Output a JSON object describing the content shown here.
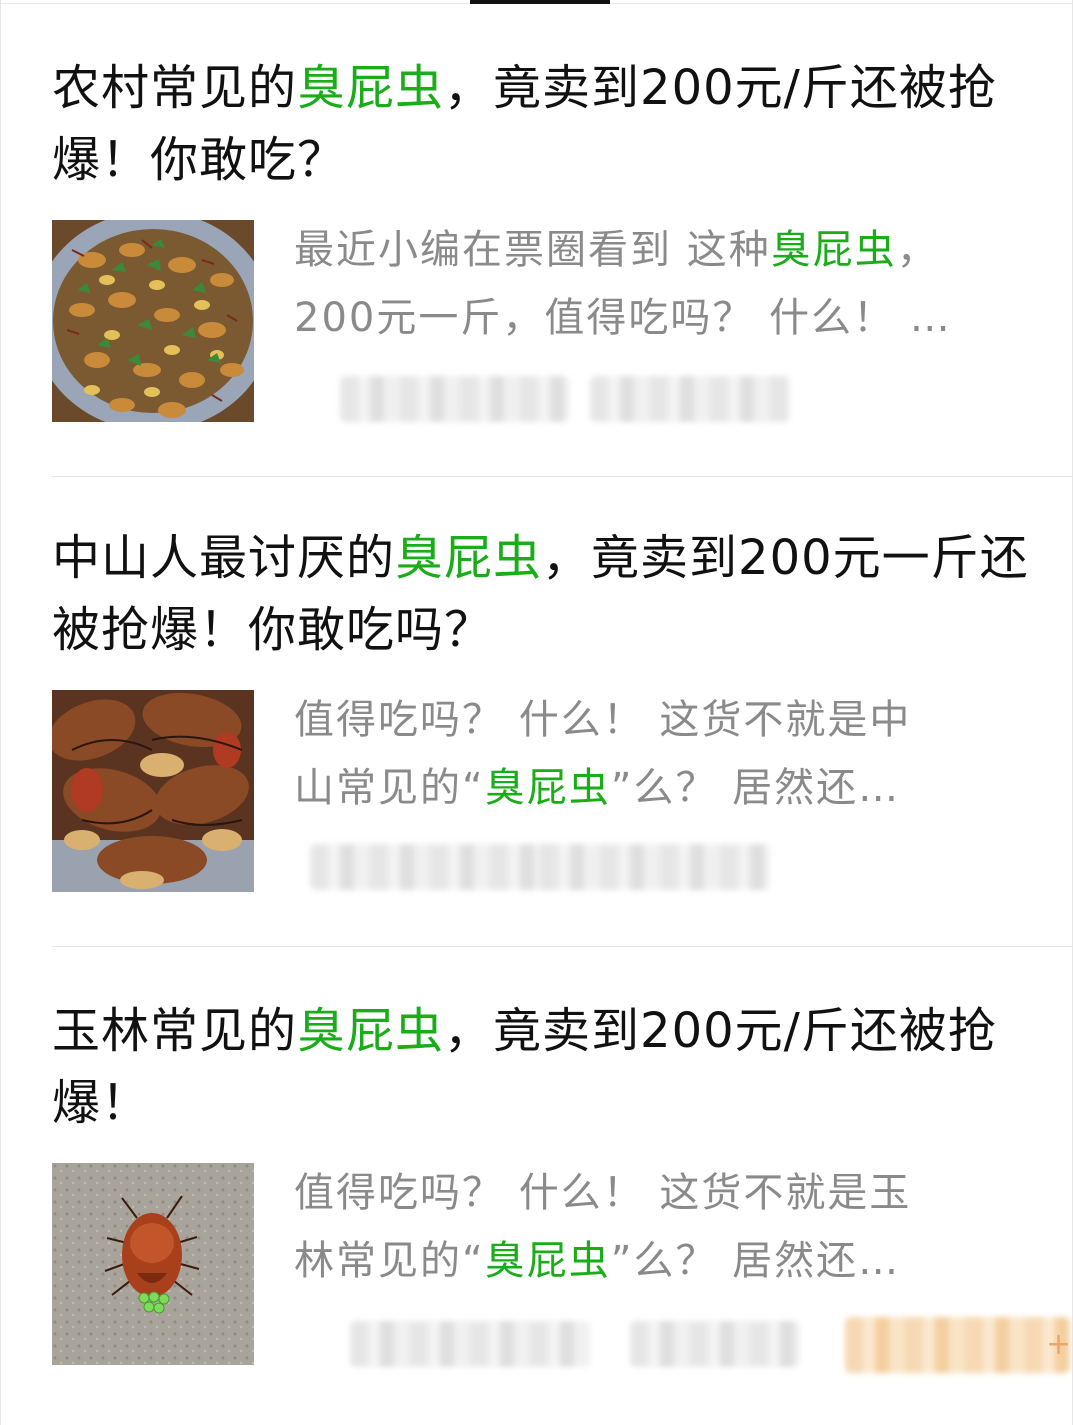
{
  "highlight_color": "#1aad19",
  "results": [
    {
      "title_before": "农村常见的",
      "title_hl": "臭屁虫",
      "title_after": "，竟卖到200元/斤还被抢爆！你敢吃？",
      "snippet_line1_before": "最近小编在票圈看到 这种",
      "snippet_line1_hl": "臭屁虫",
      "snippet_line1_after": "，",
      "snippet_line2": "200元一斤，值得吃吗？ 什么！ …",
      "thumb_icon": "fried-insects-plate-image"
    },
    {
      "title_before": "中山人最讨厌的",
      "title_hl": "臭屁虫",
      "title_after": "，竟卖到200元一斤还被抢爆！你敢吃吗？",
      "snippet_line1": "值得吃吗？ 什么！ 这货不就是中",
      "snippet_line2_before": "山常见的“",
      "snippet_line2_hl": "臭屁虫",
      "snippet_line2_after": "”么？ 居然还…",
      "thumb_icon": "fried-bugs-closeup-image"
    },
    {
      "title_before": "玉林常见的",
      "title_hl": "臭屁虫",
      "title_after": "，竟卖到200元/斤还被抢爆！",
      "snippet_line1": "值得吃吗？ 什么！ 这货不就是玉",
      "snippet_line2_before": "林常见的“",
      "snippet_line2_hl": "臭屁虫",
      "snippet_line2_after": "”么？ 居然还…",
      "thumb_icon": "stink-bug-with-eggs-image",
      "tag_tail": "+"
    }
  ]
}
